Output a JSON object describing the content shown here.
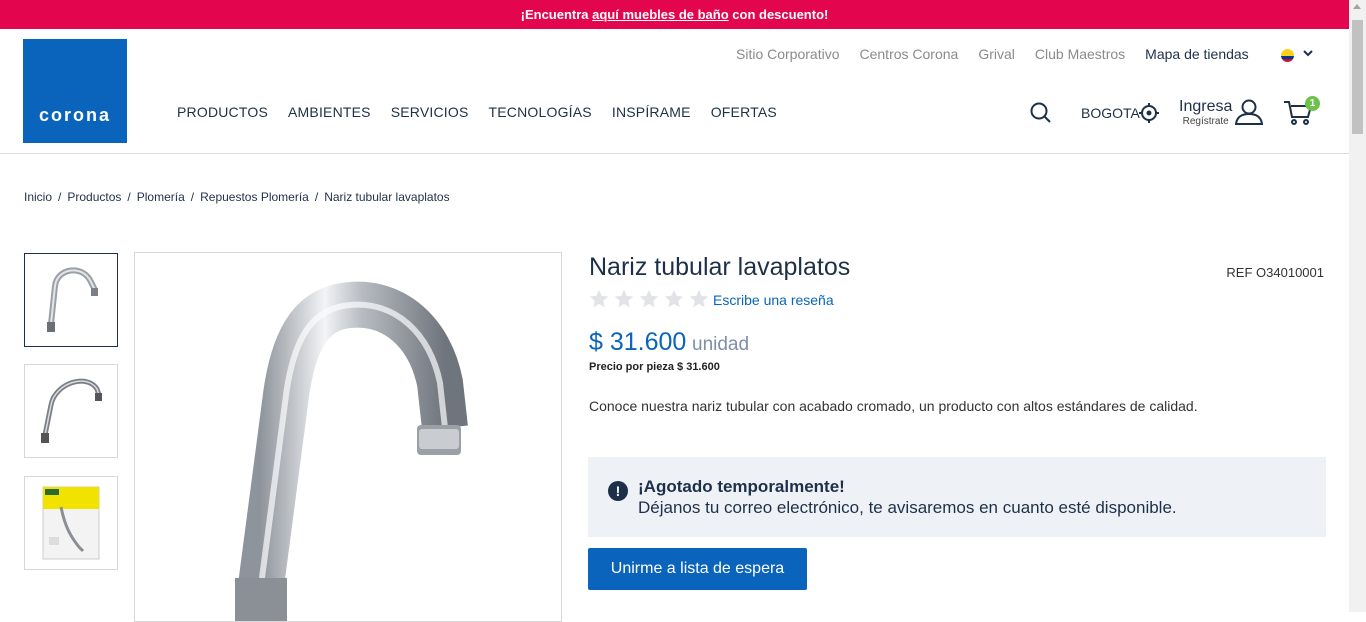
{
  "promo": {
    "prefix": "¡Encuentra ",
    "link": "aquí muebles de baño",
    "suffix": " con descuento!"
  },
  "logo": {
    "text": "corona"
  },
  "top_links": [
    "Sitio Corporativo",
    "Centros Corona",
    "Grival",
    "Club Maestros",
    "Mapa de tiendas"
  ],
  "main_nav": [
    "PRODUCTOS",
    "AMBIENTES",
    "SERVICIOS",
    "TECNOLOGÍAS",
    "INSPÍRAME",
    "OFERTAS"
  ],
  "header": {
    "city": "BOGOTA",
    "login": "Ingresa",
    "register": "Regístrate",
    "cart_count": "1"
  },
  "breadcrumb": [
    "Inicio",
    "Productos",
    "Plomería",
    "Repuestos Plomería",
    "Nariz tubular lavaplatos"
  ],
  "product": {
    "title": "Nariz tubular lavaplatos",
    "ref": "REF O34010001",
    "rating": 0,
    "review_link": "Escribe una reseña",
    "price": "$ 31.600",
    "unit": "unidad",
    "price_per_piece": "Precio por pieza $ 31.600",
    "description": "Conoce nuestra nariz tubular con acabado cromado, un producto con altos estándares de calidad."
  },
  "alert": {
    "title": "¡Agotado temporalmente!",
    "message": "Déjanos tu correo electrónico, te avisaremos en cuanto esté disponible."
  },
  "wait_button": "Unirme a lista de espera",
  "colors": {
    "brand": "#0a64bc",
    "promo": "#e4054f",
    "badge": "#6cc24a",
    "text": "#1e3049"
  }
}
